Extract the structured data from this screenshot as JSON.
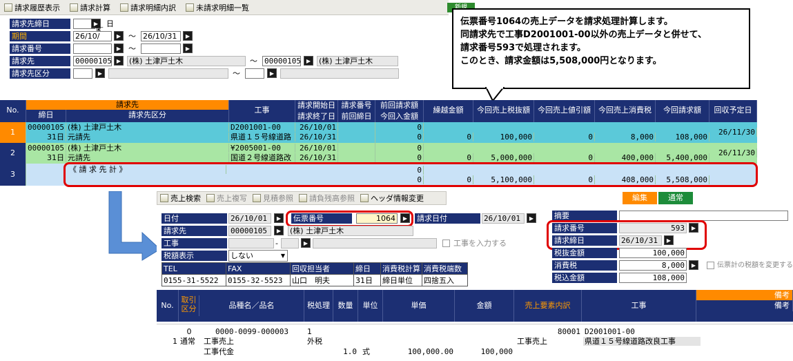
{
  "toolbar": {
    "items": [
      "請求履歴表示",
      "請求計算",
      "請求明細内訳",
      "未請求明細一覧"
    ],
    "new_label": "新規"
  },
  "search": {
    "closing_day_label": "請求先締日",
    "closing_day_unit": "日",
    "period_label": "期間",
    "period_from": "26/10/",
    "period_to": "26/10/31",
    "tilde": "～",
    "invoice_no_label": "請求番号",
    "customer_label": "請求先",
    "customer_from_code": "00000105",
    "customer_from_name": "(株) 土津戸土木",
    "customer_to_code": "00000105",
    "customer_to_name": "(株) 土津戸土木",
    "customer_class_label": "請求先区分"
  },
  "callout": {
    "lines": [
      "伝票番号1064の売上データを請求処理計算します。",
      "同請求先で工事D2001001-00以外の売上データと併せて、",
      "請求番号593で処理されます。",
      "このとき、請求金額は5,508,000円となります。"
    ]
  },
  "grid": {
    "headers": {
      "no": "No.",
      "customer_group": "請求先",
      "closing_day": "締日",
      "customer_class": "請求先区分",
      "construction": "工事",
      "start_date": "請求開始日",
      "end_date": "請求終了日",
      "invoice_no": "請求番号",
      "prev_closing": "前回締日",
      "prev_invoice_amount": "前回請求額",
      "this_receipt": "今回入金額",
      "carryover": "繰越金額",
      "sales_ex_tax": "今回売上税抜額",
      "discount": "今回売上値引額",
      "tax": "今回売上消費税",
      "invoice_amount": "今回請求額",
      "collection_date": "回収予定日"
    },
    "rows": [
      {
        "no": "1",
        "code": "00000105",
        "name": "(株) 土津戸土木",
        "closing": "31日",
        "class": "元請先",
        "construction_code": "D2001001-00",
        "construction_name": "県道１５号線道路",
        "start": "26/10/01",
        "end": "26/10/31",
        "prev_amount": "0",
        "receipt": "0",
        "carryover": "0",
        "sales": "100,000",
        "discount": "0",
        "tax": "8,000",
        "invoice": "108,000",
        "collection": "26/11/30"
      },
      {
        "no": "2",
        "code": "00000105",
        "name": "(株) 土津戸土木",
        "closing": "31日",
        "class": "元請先",
        "construction_code": "¥2005001-00",
        "construction_name": "国道２号線道路改",
        "start": "26/10/01",
        "end": "26/10/31",
        "prev_amount": "0",
        "receipt": "0",
        "carryover": "0",
        "sales": "5,000,000",
        "discount": "0",
        "tax": "400,000",
        "invoice": "5,400,000",
        "collection": "26/11/30"
      },
      {
        "no": "3",
        "label": "《 請 求 先 計 》",
        "prev_amount": "0",
        "receipt": "0",
        "carryover": "0",
        "sales": "5,100,000",
        "discount": "0",
        "tax": "408,000",
        "invoice": "5,508,000"
      }
    ]
  },
  "lower": {
    "toolbar": [
      "売上検索",
      "売上複写",
      "見積参照",
      "請負残高参照",
      "ヘッダ情報変更"
    ],
    "mode_edit": "編集",
    "mode_normal": "通常",
    "date_label": "日付",
    "date_value": "26/10/01",
    "slip_no_label": "伝票番号",
    "slip_no_value": "1064",
    "invoice_date_label": "請求日付",
    "invoice_date_value": "26/10/01",
    "customer_label": "請求先",
    "customer_code": "00000105",
    "customer_name": "(株) 土津戸土木",
    "construction_label": "工事",
    "construction_dash": "-",
    "construction_checkbox": "工事を入力する",
    "tax_display_label": "税額表示",
    "tax_display_value": "しない",
    "memo_label": "摘要",
    "invoice_no_label": "請求番号",
    "invoice_no_value": "593",
    "invoice_close_label": "請求締日",
    "invoice_close_value": "26/10/31",
    "ex_tax_label": "税抜金額",
    "ex_tax_value": "100,000",
    "tax_label": "消費税",
    "tax_value": "8,000",
    "tax_change_checkbox": "伝票計の税額を変更する",
    "inc_tax_label": "税込金額",
    "inc_tax_value": "108,000",
    "contact": {
      "headers": [
        "TEL",
        "FAX",
        "回収担当者",
        "締日",
        "消費税計算",
        "消費税端数"
      ],
      "values": [
        "0155-31-5522",
        "0155-32-5523",
        "山口　明夫",
        "31日",
        "締日単位",
        "四捨五入"
      ]
    },
    "detail_headers": {
      "no": "No.",
      "type": "取引\n区分",
      "item": "品種名／品名",
      "tax_process": "税処理",
      "qty": "数量",
      "unit": "単位",
      "unit_price": "単価",
      "amount": "金額",
      "sales_element": "売上要素内訳",
      "construction": "工事",
      "remarks_top": "備考",
      "remarks": "備考"
    },
    "detail_row": {
      "no": "1",
      "type_code": "0",
      "type_name": "通常",
      "item_code": "0000-0099-000003",
      "item_name": "工事売上",
      "item_name2": "工事代金",
      "tax_code": "1",
      "tax_name": "外税",
      "qty": "1.0",
      "unit": "式",
      "unit_price": "100,000.00",
      "amount": "100,000",
      "element_code": "80001",
      "element_name": "工事売上",
      "construction_code": "D2001001-00",
      "construction_name": "県道１５号線道路改良工事"
    }
  },
  "colors": {
    "label_bg": "#1c2f73",
    "header_orange": "#ff8a00",
    "row_blue": "#5bc9d9",
    "row_green": "#a9e6a4",
    "highlight_red": "#e00000",
    "arrow_blue": "#5a8fd6"
  }
}
